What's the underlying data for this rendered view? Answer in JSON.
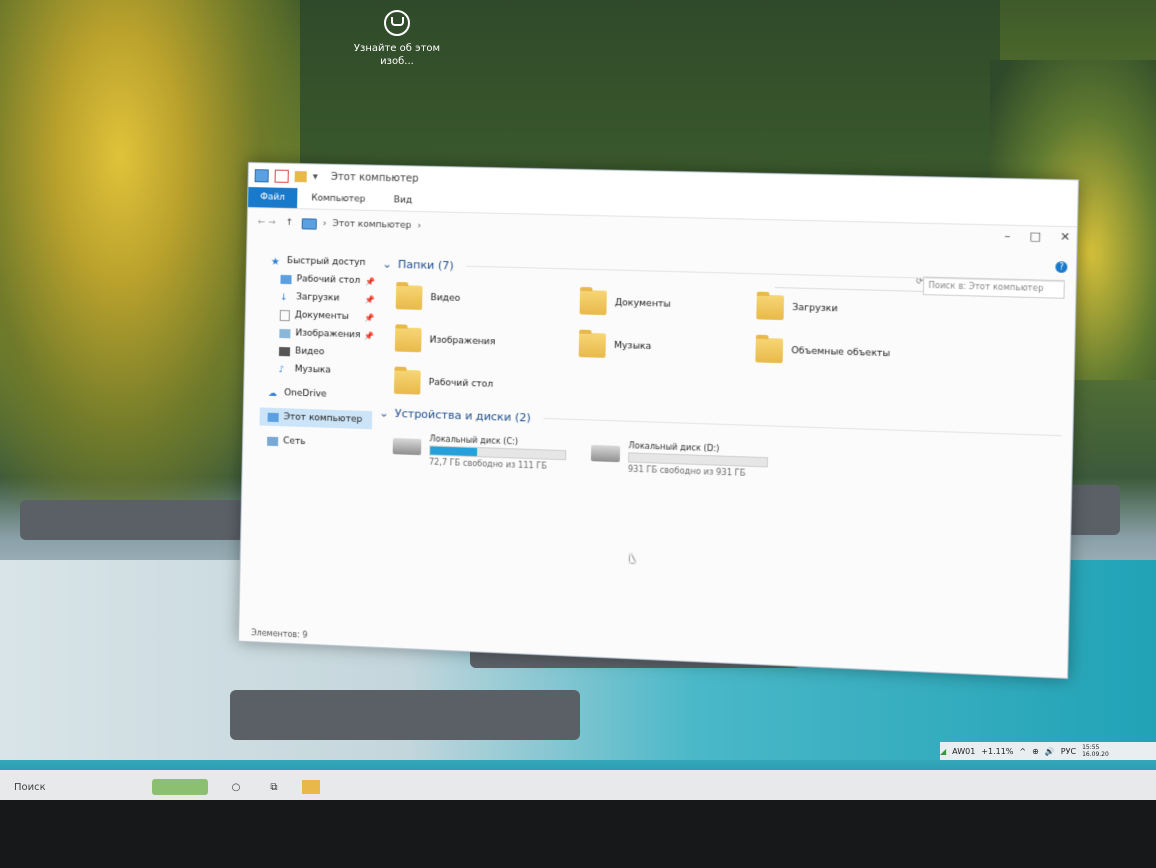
{
  "desktop": {
    "learn_more_icon_label": "Узнайте об этом изоб..."
  },
  "window": {
    "title": "Этот компьютер",
    "ribbon_tabs": [
      "Файл",
      "Компьютер",
      "Вид"
    ],
    "address": {
      "path_root": "Этот компьютер",
      "chevron": "›"
    },
    "search_placeholder": "Поиск в: Этот компьютер",
    "controls": [
      "–",
      "□",
      "✕"
    ],
    "help": "?"
  },
  "nav": {
    "quick_access": "Быстрый доступ",
    "quick_items": [
      "Рабочий стол",
      "Загрузки",
      "Документы",
      "Изображения",
      "Видео",
      "Музыка"
    ],
    "onedrive": "OneDrive",
    "this_pc": "Этот компьютер",
    "network": "Сеть"
  },
  "content": {
    "folders_header": "Папки (7)",
    "folders": [
      "Видео",
      "Документы",
      "Загрузки",
      "Изображения",
      "Музыка",
      "Объемные объекты",
      "Рабочий стол"
    ],
    "devices_header": "Устройства и диски (2)",
    "drives": [
      {
        "name": "Локальный диск (C:)",
        "free": "72,7 ГБ свободно из 111 ГБ",
        "used_fraction": 0.35
      },
      {
        "name": "Локальный диск (D:)",
        "free": "931 ГБ свободно из 931 ГБ",
        "used_fraction": 0.0
      }
    ]
  },
  "status": {
    "items": "Элементов: 9"
  },
  "tray": {
    "network_name": "AW01",
    "percent": "+1.11%",
    "lang": "РУС",
    "time": "15:55",
    "date": "16.09.20"
  },
  "taskbar": {
    "search": "Поиск"
  }
}
